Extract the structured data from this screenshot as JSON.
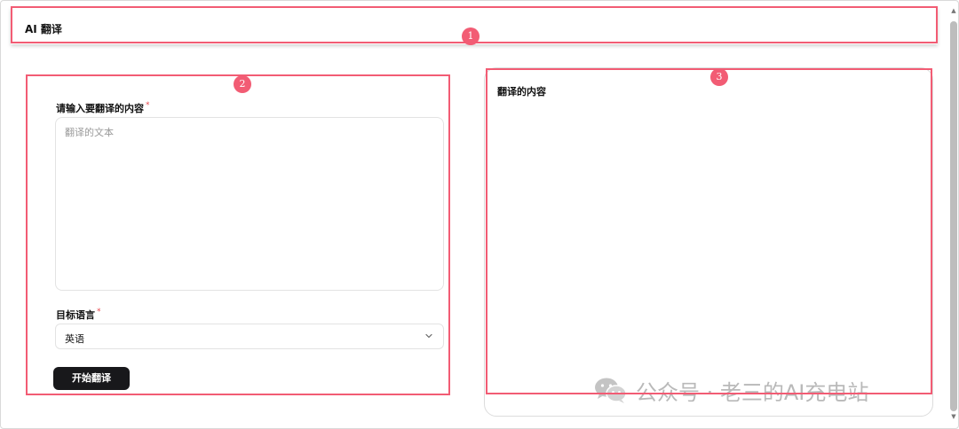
{
  "header": {
    "title": "AI 翻译"
  },
  "form": {
    "input_label": "请输入要翻译的内容",
    "required_mark": "*",
    "input_placeholder": "翻译的文本",
    "language_label": "目标语言",
    "language_value": "英语",
    "submit_label": "开始翻译"
  },
  "output": {
    "title": "翻译的内容"
  },
  "annotations": {
    "marker_1": "1",
    "marker_2": "2",
    "marker_3": "3",
    "color": "#f25c74"
  },
  "watermark": {
    "text": "公众号 · 老三的AI充电站",
    "icon": "wechat-icon"
  },
  "icons": {
    "select_arrow": "chevron-down-icon"
  }
}
